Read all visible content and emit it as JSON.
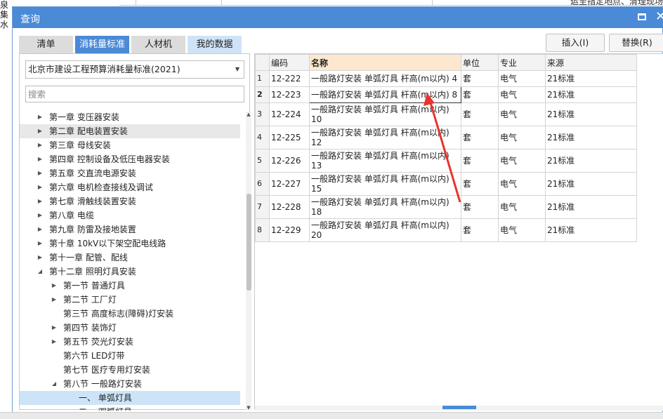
{
  "background": {
    "left_text": "泉\n集水",
    "strip_text": "运至指定地点、清理现场等"
  },
  "dialog": {
    "title": "查询"
  },
  "tabs": [
    {
      "label": "清单"
    },
    {
      "label": "消耗量标准"
    },
    {
      "label": "人材机"
    },
    {
      "label": "我的数据"
    }
  ],
  "library": {
    "selected": "北京市建设工程预算消耗量标准(2021)"
  },
  "search": {
    "placeholder": "搜索"
  },
  "tree": [
    {
      "label": "第一章 变压器安装",
      "expandable": true
    },
    {
      "label": "第二章 配电装置安装",
      "expandable": true
    },
    {
      "label": "第三章 母线安装",
      "expandable": true
    },
    {
      "label": "第四章 控制设备及低压电器安装",
      "expandable": true
    },
    {
      "label": "第五章 交直流电源安装",
      "expandable": true
    },
    {
      "label": "第六章 电机检查接线及调试",
      "expandable": true
    },
    {
      "label": "第七章 滑触线装置安装",
      "expandable": true
    },
    {
      "label": "第八章 电缆",
      "expandable": true
    },
    {
      "label": "第九章 防雷及接地装置",
      "expandable": true
    },
    {
      "label": "第十章 10kV以下架空配电线路",
      "expandable": true
    },
    {
      "label": "第十一章 配管、配线",
      "expandable": true
    },
    {
      "label": "第十二章 照明灯具安装",
      "expandable": true,
      "expanded": true
    },
    {
      "label": "第一节 普通灯具",
      "expandable": true
    },
    {
      "label": "第二节 工厂灯",
      "expandable": true
    },
    {
      "label": "第三节 高度标志(障碍)灯安装",
      "expandable": false
    },
    {
      "label": "第四节 装饰灯",
      "expandable": true
    },
    {
      "label": "第五节 荧光灯安装",
      "expandable": true
    },
    {
      "label": "第六节 LED灯带",
      "expandable": false
    },
    {
      "label": "第七节 医疗专用灯安装",
      "expandable": false
    },
    {
      "label": "第八节 一般路灯安装",
      "expandable": true,
      "expanded": true
    },
    {
      "label": "一、 单弧灯具",
      "expandable": false
    },
    {
      "label": "二、 双弧灯具",
      "expandable": false
    }
  ],
  "buttons": {
    "insert": "插入(I)",
    "replace": "替换(R)"
  },
  "grid": {
    "columns": [
      "",
      "编码",
      "名称",
      "单位",
      "专业",
      "来源"
    ],
    "rows": [
      {
        "num": "1",
        "code": "12-222",
        "name": "一般路灯安装 单弧灯具 杆高(m以内) 4",
        "unit": "套",
        "major": "电气",
        "source": "21标准"
      },
      {
        "num": "2",
        "code": "12-223",
        "name": "一般路灯安装 单弧灯具 杆高(m以内) 8",
        "unit": "套",
        "major": "电气",
        "source": "21标准"
      },
      {
        "num": "3",
        "code": "12-224",
        "name": "一般路灯安装 单弧灯具 杆高(m以内) 10",
        "unit": "套",
        "major": "电气",
        "source": "21标准"
      },
      {
        "num": "4",
        "code": "12-225",
        "name": "一般路灯安装 单弧灯具 杆高(m以内) 12",
        "unit": "套",
        "major": "电气",
        "source": "21标准"
      },
      {
        "num": "5",
        "code": "12-226",
        "name": "一般路灯安装 单弧灯具 杆高(m以内) 13",
        "unit": "套",
        "major": "电气",
        "source": "21标准"
      },
      {
        "num": "6",
        "code": "12-227",
        "name": "一般路灯安装 单弧灯具 杆高(m以内) 15",
        "unit": "套",
        "major": "电气",
        "source": "21标准"
      },
      {
        "num": "7",
        "code": "12-228",
        "name": "一般路灯安装 单弧灯具 杆高(m以内) 18",
        "unit": "套",
        "major": "电气",
        "source": "21标准"
      },
      {
        "num": "8",
        "code": "12-229",
        "name": "一般路灯安装 单弧灯具 杆高(m以内) 20",
        "unit": "套",
        "major": "电气",
        "source": "21标准"
      }
    ]
  },
  "colors": {
    "accent": "#4a8ad6",
    "name_header": "#fde8cf",
    "selection": "#cde4f8",
    "annotation_arrow": "#e8342c"
  }
}
